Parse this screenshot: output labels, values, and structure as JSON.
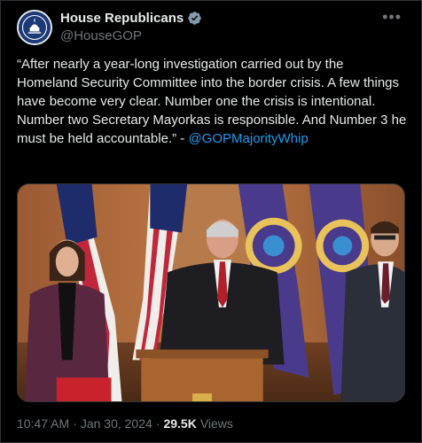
{
  "account": {
    "display_name": "House Republicans",
    "handle": "@HouseGOP",
    "verified_icon": "verified-badge-icon",
    "avatar_icon": "capitol-seal-icon"
  },
  "post": {
    "text_before_mention": "“After nearly a year-long investigation carried out by the Homeland Security Committee into the border crisis. A few things have become very clear. Number one the crisis is intentional. Number two Secretary Mayorkas is responsible. And Number 3 he must be held accountable.” - ",
    "mention": "@GOPMajorityWhip",
    "time": "10:47 AM",
    "separator": "·",
    "date": "Jan 30, 2024",
    "views_count": "29.5K",
    "views_label": "Views"
  },
  "colors": {
    "background": "#000000",
    "text": "#e7e9ea",
    "muted": "#71767b",
    "link": "#1d9bf0",
    "verified": "#829aab"
  }
}
